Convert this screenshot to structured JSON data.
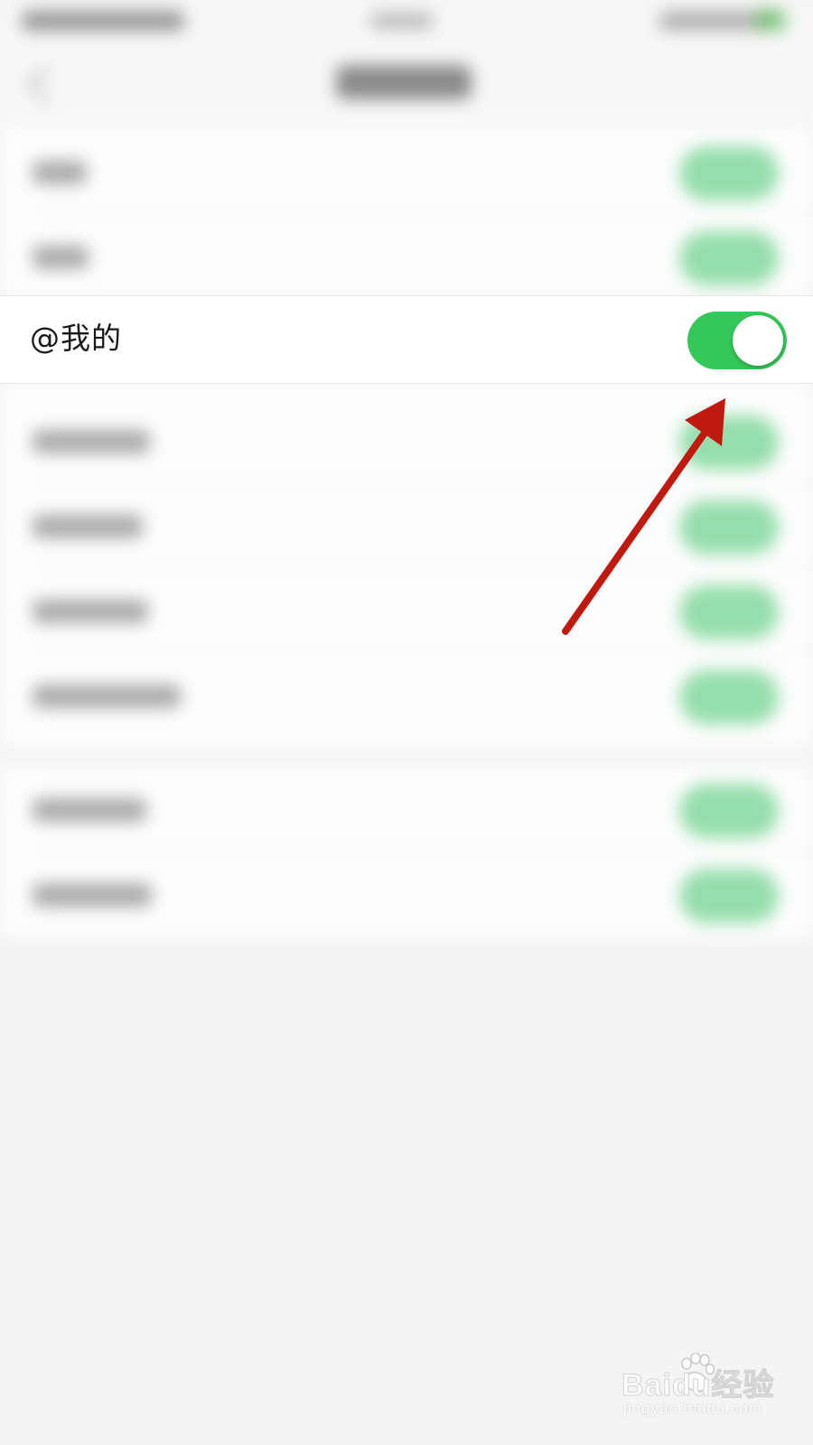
{
  "setting_row": {
    "label": "@我的",
    "toggle_on": true,
    "toggle_color": "#34c759"
  },
  "annotation": {
    "arrow_color": "#c0190f"
  },
  "watermark": {
    "logo": "Baidu经验",
    "url": "jingyan.baidu.com"
  }
}
